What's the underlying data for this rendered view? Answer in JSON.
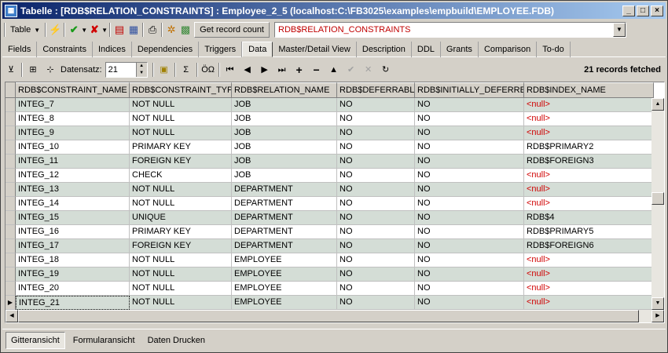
{
  "window": {
    "title": "Tabelle : [RDB$RELATION_CONSTRAINTS] : Employee_2_5 (localhost:C:\\FB3025\\examples\\empbuild\\EMPLOYEE.FDB)"
  },
  "toolbar": {
    "table_label": "Table",
    "get_record_count_label": "Get record count",
    "relation_name": "RDB$RELATION_CONSTRAINTS"
  },
  "tabs": [
    {
      "label": "Fields"
    },
    {
      "label": "Constraints"
    },
    {
      "label": "Indices"
    },
    {
      "label": "Dependencies"
    },
    {
      "label": "Triggers"
    },
    {
      "label": "Data"
    },
    {
      "label": "Master/Detail View"
    },
    {
      "label": "Description"
    },
    {
      "label": "DDL"
    },
    {
      "label": "Grants"
    },
    {
      "label": "Comparison"
    },
    {
      "label": "To-do"
    }
  ],
  "navbar": {
    "datensatz_label": "Datensatz:",
    "datensatz_value": "21",
    "fetched_label": "21 records fetched"
  },
  "grid": {
    "columns": [
      "RDB$CONSTRAINT_NAME",
      "RDB$CONSTRAINT_TYPE",
      "RDB$RELATION_NAME",
      "RDB$DEFERRABLE",
      "RDB$INITIALLY_DEFERRED",
      "RDB$INDEX_NAME"
    ],
    "rows": [
      [
        "INTEG_7",
        "NOT NULL",
        "JOB",
        "NO",
        "NO",
        "<null>"
      ],
      [
        "INTEG_8",
        "NOT NULL",
        "JOB",
        "NO",
        "NO",
        "<null>"
      ],
      [
        "INTEG_9",
        "NOT NULL",
        "JOB",
        "NO",
        "NO",
        "<null>"
      ],
      [
        "INTEG_10",
        "PRIMARY KEY",
        "JOB",
        "NO",
        "NO",
        "RDB$PRIMARY2"
      ],
      [
        "INTEG_11",
        "FOREIGN KEY",
        "JOB",
        "NO",
        "NO",
        "RDB$FOREIGN3"
      ],
      [
        "INTEG_12",
        "CHECK",
        "JOB",
        "NO",
        "NO",
        "<null>"
      ],
      [
        "INTEG_13",
        "NOT NULL",
        "DEPARTMENT",
        "NO",
        "NO",
        "<null>"
      ],
      [
        "INTEG_14",
        "NOT NULL",
        "DEPARTMENT",
        "NO",
        "NO",
        "<null>"
      ],
      [
        "INTEG_15",
        "UNIQUE",
        "DEPARTMENT",
        "NO",
        "NO",
        "RDB$4"
      ],
      [
        "INTEG_16",
        "PRIMARY KEY",
        "DEPARTMENT",
        "NO",
        "NO",
        "RDB$PRIMARY5"
      ],
      [
        "INTEG_17",
        "FOREIGN KEY",
        "DEPARTMENT",
        "NO",
        "NO",
        "RDB$FOREIGN6"
      ],
      [
        "INTEG_18",
        "NOT NULL",
        "EMPLOYEE",
        "NO",
        "NO",
        "<null>"
      ],
      [
        "INTEG_19",
        "NOT NULL",
        "EMPLOYEE",
        "NO",
        "NO",
        "<null>"
      ],
      [
        "INTEG_20",
        "NOT NULL",
        "EMPLOYEE",
        "NO",
        "NO",
        "<null>"
      ],
      [
        "INTEG_21",
        "NOT NULL",
        "EMPLOYEE",
        "NO",
        "NO",
        "<null>"
      ]
    ],
    "current_row": 14
  },
  "bottom": {
    "grid_view_label": "Gitteransicht",
    "form_view_label": "Formularansicht",
    "print_label": "Daten Drucken"
  },
  "colors": {
    "null_text": "#d00000",
    "alt_row": "#d4ddd6",
    "title_start": "#0a246a"
  }
}
